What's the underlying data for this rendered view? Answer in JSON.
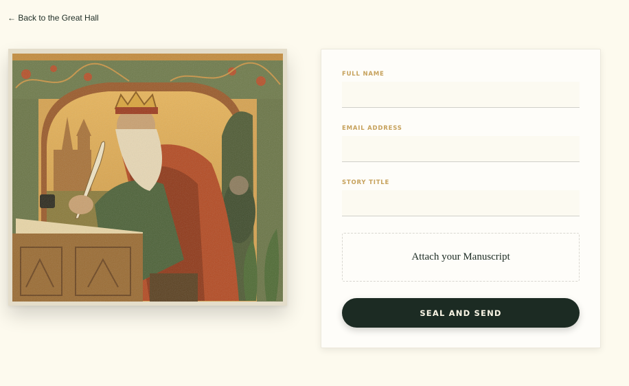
{
  "nav": {
    "back_label": "← Back to the Great Hall"
  },
  "illustration": {
    "icon": "scribe-king-illustration"
  },
  "form": {
    "fields": [
      {
        "label": "FULL NAME",
        "value": "",
        "placeholder": ""
      },
      {
        "label": "EMAIL ADDRESS",
        "value": "",
        "placeholder": ""
      },
      {
        "label": "STORY TITLE",
        "value": "",
        "placeholder": ""
      }
    ],
    "attach_label": "Attach your Manuscript",
    "submit_label": "SEAL AND SEND"
  },
  "colors": {
    "background": "#fdfaee",
    "accent_gold": "#c6a15b",
    "button_dark": "#1c2b23"
  }
}
